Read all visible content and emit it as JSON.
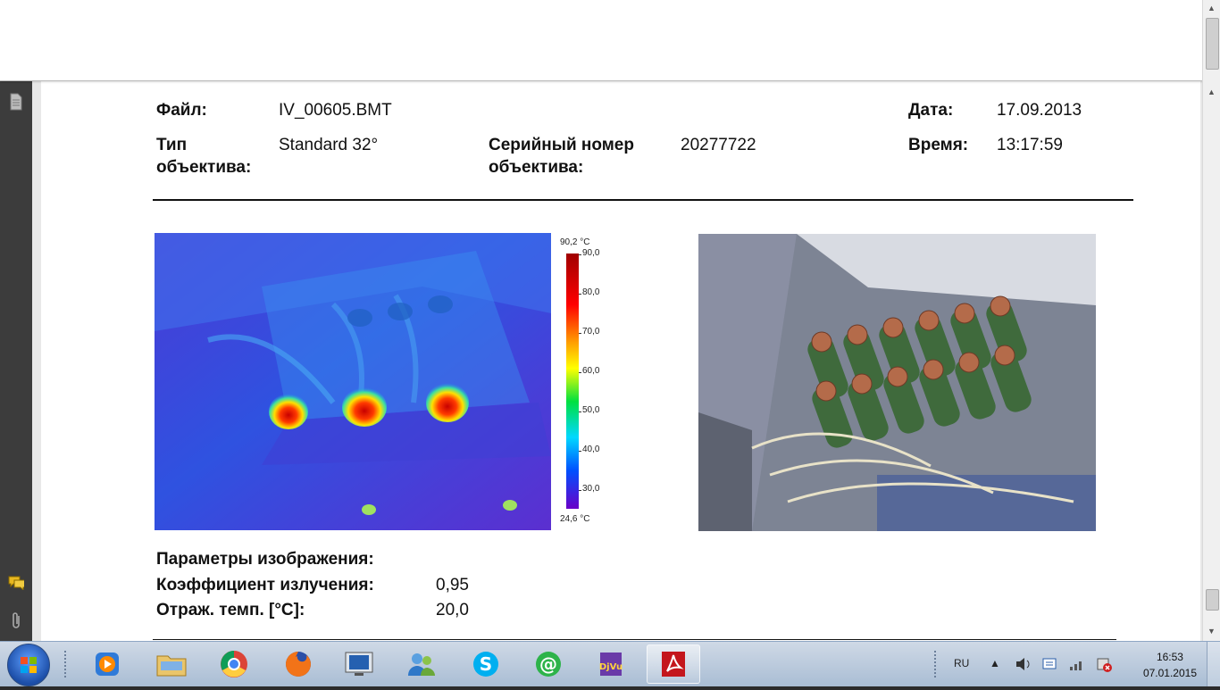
{
  "header": {
    "file_label": "Файл:",
    "file_value": "IV_00605.BMT",
    "lens_type_label": "Тип объектива:",
    "lens_type_value": "Standard 32°",
    "lens_serial_label": "Серийный номер объектива:",
    "lens_serial_value": "20277722",
    "date_label": "Дата:",
    "date_value": "17.09.2013",
    "time_label": "Время:",
    "time_value": "13:17:59"
  },
  "thermal_scale": {
    "max_label": "90,2 °C",
    "min_label": "24,6 °C",
    "ticks": [
      "90,0",
      "80,0",
      "70,0",
      "60,0",
      "50,0",
      "40,0",
      "30,0"
    ]
  },
  "params": {
    "title": "Параметры изображения:",
    "emissivity_label": "Коэффициент излучения:",
    "emissivity_value": "0,95",
    "refl_temp_label": "Отраж. темп. [°C]:",
    "refl_temp_value": "20,0"
  },
  "taskbar": {
    "apps": [
      "windows-media-player",
      "file-explorer",
      "chrome",
      "firefox",
      "remote-desktop",
      "messenger",
      "skype",
      "mail-agent",
      "djvu-viewer",
      "adobe-reader"
    ],
    "active_app": "adobe-reader",
    "language": "RU",
    "time": "16:53",
    "date": "07.01.2015"
  },
  "colors": {
    "thermal_hot": "#d40000",
    "thermal_cold": "#5a2bd8",
    "taskbar": "#b9c8da"
  }
}
